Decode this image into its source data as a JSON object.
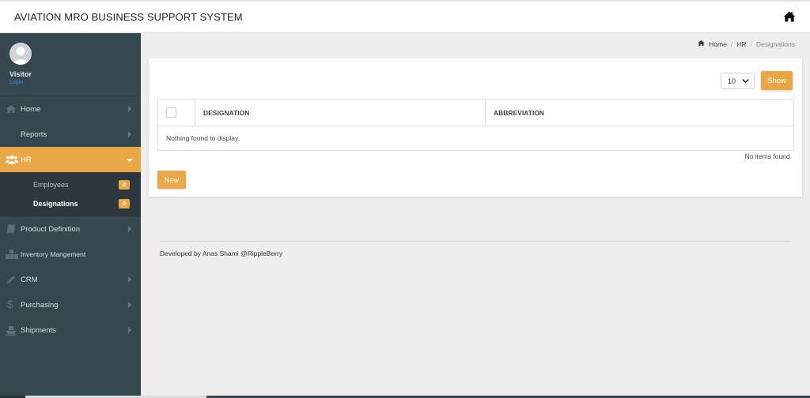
{
  "app": {
    "title": "AVIATION MRO BUSINESS SUPPORT SYSTEM",
    "home_icon": "home-icon"
  },
  "user": {
    "name": "Visitor",
    "login_label": "Login"
  },
  "sidebar": {
    "items": [
      {
        "label": "Home",
        "icon": "home-icon",
        "has_arrow": true
      },
      {
        "label": "Reports",
        "icon": "",
        "has_arrow": true
      },
      {
        "label": "HR",
        "icon": "users-icon",
        "active": true,
        "expanded": true,
        "children": [
          {
            "label": "Employees",
            "count": "0"
          },
          {
            "label": "Designations",
            "count": "0",
            "current": true
          }
        ]
      },
      {
        "label": "Product Definition",
        "icon": "book-icon",
        "has_arrow": true
      },
      {
        "label": "Inventory Mangement",
        "icon": "boxes-icon",
        "has_arrow": false
      },
      {
        "label": "CRM",
        "icon": "pencil-icon",
        "has_arrow": true
      },
      {
        "label": "Purchasing",
        "icon": "dollar-icon",
        "has_arrow": true
      },
      {
        "label": "Shipments",
        "icon": "ship-icon",
        "has_arrow": true
      }
    ]
  },
  "breadcrumb": {
    "home": "Home",
    "section": "HR",
    "current": "Designations",
    "separator": "/"
  },
  "toolbar": {
    "page_size": "10",
    "show_label": "Show"
  },
  "table": {
    "columns": [
      "DESIGNATION",
      "ABBREVIATION"
    ],
    "empty_message": "Nothing found to display.",
    "status": "No items found."
  },
  "actions": {
    "new_label": "New"
  },
  "footer": {
    "text": "Developed by Anas Shami @RippleBerry"
  },
  "colors": {
    "accent": "#e9a745",
    "sidebar_bg": "#37474f",
    "submenu_bg": "#2c383e",
    "page_bg": "#eeeeee"
  }
}
